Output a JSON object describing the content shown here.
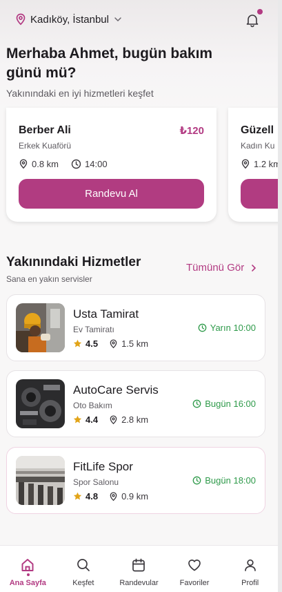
{
  "header": {
    "location": "Kadıköy, İstanbul",
    "greeting": "Merhaba Ahmet, bugün bakım günü mü?",
    "subtitle": "Yakınındaki en iyi hizmetleri keşfet"
  },
  "featured": [
    {
      "name": "Berber Ali",
      "price": "₺120",
      "category": "Erkek Kuaförü",
      "distance": "0.8 km",
      "time": "14:00",
      "button": "Randevu Al"
    },
    {
      "name": "Güzell",
      "category": "Kadın Ku",
      "distance": "1.2 km"
    }
  ],
  "section": {
    "title": "Yakınındaki Hizmetler",
    "subtitle": "Sana en yakın servisler",
    "see_all": "Tümünü Gör"
  },
  "services": [
    {
      "name": "Usta Tamirat",
      "category": "Ev Tamiratı",
      "rating": "4.5",
      "distance": "1.5 km",
      "availability": "Yarın 10:00"
    },
    {
      "name": "AutoCare Servis",
      "category": "Oto Bakım",
      "rating": "4.4",
      "distance": "2.8 km",
      "availability": "Bugün 16:00"
    },
    {
      "name": "FitLife Spor",
      "category": "Spor Salonu",
      "rating": "4.8",
      "distance": "0.9 km",
      "availability": "Bugün 18:00"
    }
  ],
  "nav": [
    {
      "label": "Ana Sayfa",
      "icon": "home-icon",
      "active": true
    },
    {
      "label": "Keşfet",
      "icon": "search-icon"
    },
    {
      "label": "Randevular",
      "icon": "calendar-icon"
    },
    {
      "label": "Favoriler",
      "icon": "heart-icon"
    },
    {
      "label": "Profil",
      "icon": "user-icon"
    }
  ],
  "colors": {
    "accent": "#b23a82",
    "available": "#2e9a4a",
    "star": "#e2a418"
  }
}
